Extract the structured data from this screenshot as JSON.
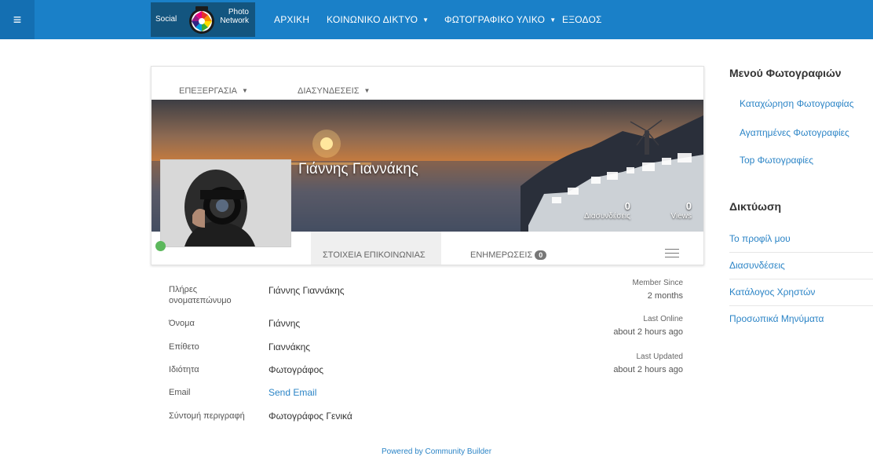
{
  "topbar": {
    "menu_toggle": "≡",
    "logo": {
      "left_text": "Social",
      "right_line1": "Photo",
      "right_line2": "Network"
    },
    "nav": [
      {
        "label": "ΑΡΧΙΚΗ",
        "dropdown": false
      },
      {
        "label": "ΚΟΙΝΩΝΙΚΟ ΔΙΚΤΥΟ",
        "dropdown": true
      },
      {
        "label": "ΦΩΤΟΓΡΑΦΙΚΟ ΥΛΙΚΟ",
        "dropdown": true
      },
      {
        "label": "ΕΞΟΔΟΣ",
        "dropdown": false
      }
    ],
    "color": "#1a80c8"
  },
  "profile": {
    "menu": [
      {
        "label": "ΕΠΕΞΕΡΓΑΣΙΑ"
      },
      {
        "label": "ΔΙΑΣΥΝΔΕΣΕΙΣ"
      }
    ],
    "name": "Γιάννης Γιαννάκης",
    "stats": [
      {
        "value": "0",
        "label": "Διασυνδέσεις"
      },
      {
        "value": "0",
        "label": "Views"
      }
    ],
    "tabs": [
      {
        "label": "ΣΤΟΙΧΕΙΑ ΕΠΙΚΟΙΝΩΝΙΑΣ",
        "active": true
      },
      {
        "label": "ΕΝΗΜΕΡΩΣΕΙΣ",
        "badge": "0",
        "active": false
      }
    ],
    "online_status_color": "#5cb85c",
    "details": [
      {
        "label": "Πλήρες ονοματεπώνυμο",
        "value": "Γιάννης Γιαννάκης"
      },
      {
        "label": "Όνομα",
        "value": "Γιάννης"
      },
      {
        "label": "Επίθετο",
        "value": "Γιαννάκης"
      },
      {
        "label": "Ιδιότητα",
        "value": "Φωτογράφος"
      },
      {
        "label": "Email",
        "value": "Send Email",
        "link": true
      },
      {
        "label": "Σύντομή περιγραφή",
        "value": "Φωτογράφος Γενικά"
      }
    ],
    "meta": [
      {
        "label": "Member Since",
        "value": "2 months"
      },
      {
        "label": "Last Online",
        "value": "about 2 hours ago"
      },
      {
        "label": "Last Updated",
        "value": "about 2 hours ago"
      }
    ]
  },
  "sidebar": {
    "photo_menu_title": "Μενού Φωτογραφιών",
    "photo_links": [
      "Καταχώρηση Φωτογραφίας",
      "Αγαπημένες Φωτογραφίες",
      "Top Φωτογραφίες"
    ],
    "network_title": "Δικτύωση",
    "network_links": [
      "Το προφίλ μου",
      "Διασυνδέσεις",
      "Κατάλογος Χρηστών",
      "Προσωπικά Μηνύματα"
    ],
    "link_color": "#2b84c6"
  },
  "footer": {
    "text": "Powered by Community Builder"
  }
}
